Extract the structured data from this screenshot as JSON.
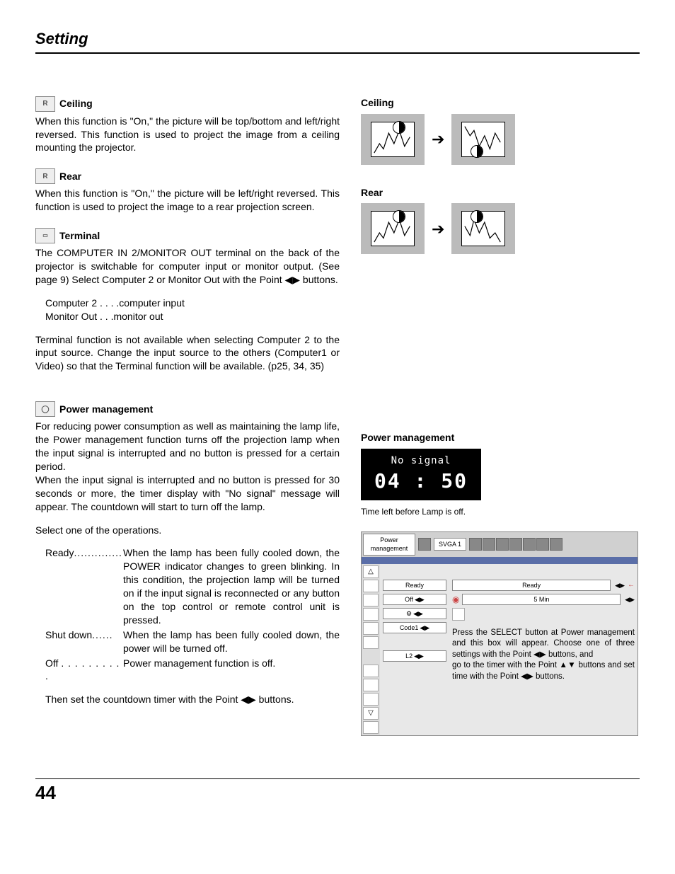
{
  "page": {
    "title": "Setting",
    "number": "44"
  },
  "left": {
    "ceiling": {
      "title": "Ceiling",
      "body": "When this function is \"On,\" the picture will be top/bottom and left/right reversed.  This function is used to project the image from a ceiling mounting the  projector."
    },
    "rear": {
      "title": "Rear",
      "body": "When this function is \"On,\" the picture will be left/right reversed.  This function is used to project the image to a rear projection screen."
    },
    "terminal": {
      "title": "Terminal",
      "body1": "The COMPUTER IN 2/MONITOR OUT terminal on the back of the projector is switchable for computer input or monitor output.  (See page 9)  Select Computer 2 or Monitor Out with the Point ◀▶ buttons.",
      "row1_term": "Computer 2",
      "row1_dots": " . . . .",
      "row1_def": "computer input",
      "row2_term": "Monitor Out",
      "row2_dots": "  . . .",
      "row2_def": "monitor out",
      "body2": "Terminal function is not available when selecting Computer 2 to the input source.  Change the input source to the others (Computer1 or Video) so that the Terminal function will be available.  (p25, 34, 35)"
    },
    "pm": {
      "title": "Power management",
      "body1": "For reducing power consumption as well as maintaining the lamp life, the Power management function turns off the projection lamp when the input signal is interrupted and no button is pressed for a certain period.",
      "body2": "When the input signal is interrupted and no button is pressed for 30 seconds or more, the timer display with \"No signal\" message will appear.  The countdown will start to turn off the lamp.",
      "select": "Select one of the operations.",
      "ready_term": "Ready",
      "ready_dots": "..............",
      "ready_def": "When the lamp has been fully cooled down, the POWER indicator changes to green blinking. In this condition, the projection lamp will be turned on if the input signal is reconnected or any button on the top control or remote control unit is pressed.",
      "shut_term": "Shut down",
      "shut_dots": "......",
      "shut_def": "When the lamp has been fully cooled down, the power will be turned off.",
      "off_term": "Off",
      "off_dots": ". . . . . . . . . .",
      "off_def": "Power management function is off.",
      "then": "Then set the countdown timer with the Point ◀▶ buttons."
    }
  },
  "right": {
    "ceiling_title": "Ceiling",
    "rear_title": "Rear",
    "pm_title": "Power management",
    "no_signal": "No signal",
    "timer": "04 : 50",
    "caption": "Time left before Lamp is off.",
    "osd": {
      "header_label": "Power management",
      "mode_label": "SVGA 1",
      "items": {
        "ready": "Ready",
        "off": "Off",
        "fan": "⚙",
        "code1": "Code1",
        "l2": "L2"
      },
      "right_ready": "Ready",
      "right_min": "5 Min"
    },
    "note1": "Press the SELECT button at Power management and this box will appear.  Choose one of three settings with the Point ◀▶ buttons, and",
    "note2": "go to the timer with the Point ▲▼ buttons and set time with the Point ◀▶ buttons."
  }
}
